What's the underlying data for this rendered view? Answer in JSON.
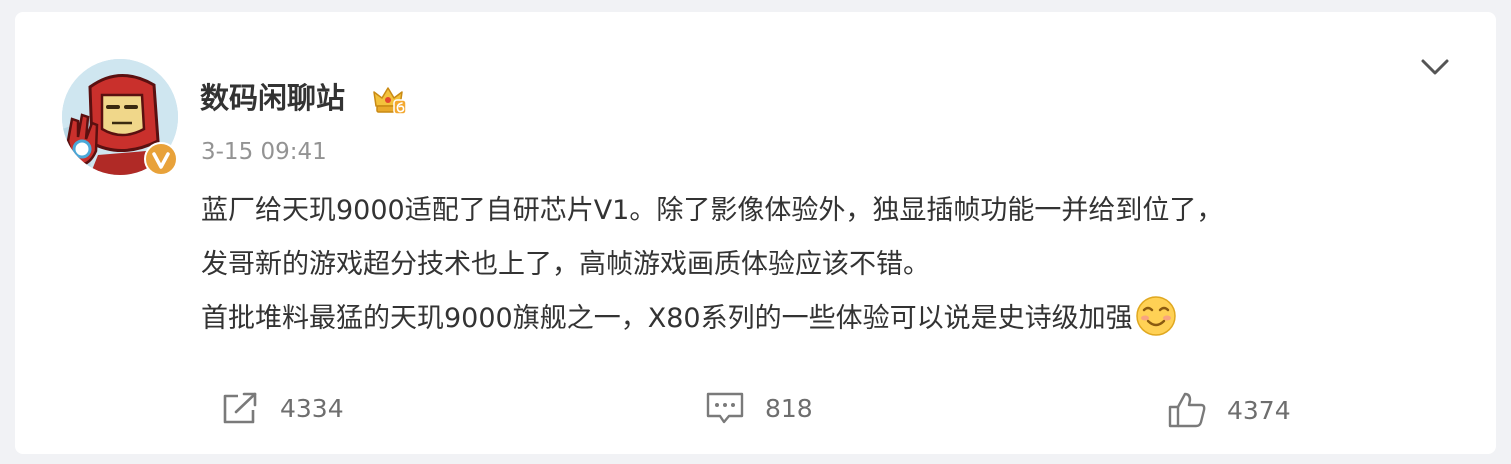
{
  "post": {
    "author": {
      "name": "数码闲聊站"
    },
    "timestamp": "3-15 09:41",
    "text_lines": [
      "蓝厂给天玑9000适配了自研芯片V1。除了影像体验外，独显插帧功能一并给到位了，",
      "发哥新的游戏超分技术也上了，高帧游戏画质体验应该不错。",
      "首批堆料最猛的天玑9000旗舰之一，X80系列的一些体验可以说是史诗级加强"
    ],
    "emoji": "smiley-icon",
    "actions": {
      "repost": {
        "icon": "share-icon",
        "count": "4334"
      },
      "comment": {
        "icon": "comment-icon",
        "count": "818"
      },
      "like": {
        "icon": "thumbs-up-icon",
        "count": "4374"
      }
    }
  },
  "colors": {
    "page_background": "#f1f2f5",
    "card_background": "#ffffff",
    "primary_text": "#333333",
    "secondary_text": "#939393",
    "action_text": "#6e6e6e",
    "badge_orange": "#e8a23a"
  }
}
